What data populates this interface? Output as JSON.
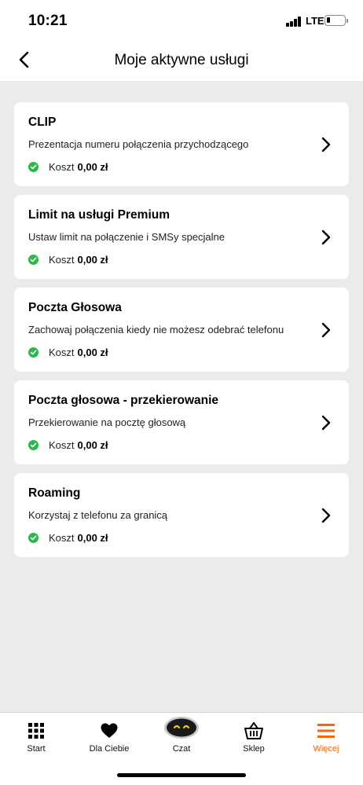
{
  "status_bar": {
    "time": "10:21",
    "network": "LTE"
  },
  "header": {
    "title": "Moje aktywne usługi"
  },
  "services": [
    {
      "title": "CLIP",
      "description": "Prezentacja numeru połączenia przychodzącego",
      "cost_label": "Koszt",
      "cost_value": "0,00 zł"
    },
    {
      "title": "Limit na usługi Premium",
      "description": "Ustaw limit na połączenie i SMSy specjalne",
      "cost_label": "Koszt",
      "cost_value": "0,00 zł"
    },
    {
      "title": "Poczta Głosowa",
      "description": "Zachowaj połączenia kiedy nie możesz odebrać telefonu",
      "cost_label": "Koszt",
      "cost_value": "0,00 zł"
    },
    {
      "title": "Poczta głosowa - przekierowanie",
      "description": "Przekierowanie na pocztę głosową",
      "cost_label": "Koszt",
      "cost_value": "0,00 zł"
    },
    {
      "title": "Roaming",
      "description": "Korzystaj z telefonu za granicą",
      "cost_label": "Koszt",
      "cost_value": "0,00 zł"
    }
  ],
  "bottom_nav": [
    {
      "label": "Start",
      "icon": "grid-icon"
    },
    {
      "label": "Dla Ciebie",
      "icon": "heart-icon"
    },
    {
      "label": "Czat",
      "icon": "chat-bot-icon"
    },
    {
      "label": "Sklep",
      "icon": "basket-icon"
    },
    {
      "label": "Więcej",
      "icon": "menu-icon",
      "active": true
    }
  ],
  "colors": {
    "accent": "#ff6600",
    "check": "#2ab94a",
    "background": "#ebebeb"
  }
}
